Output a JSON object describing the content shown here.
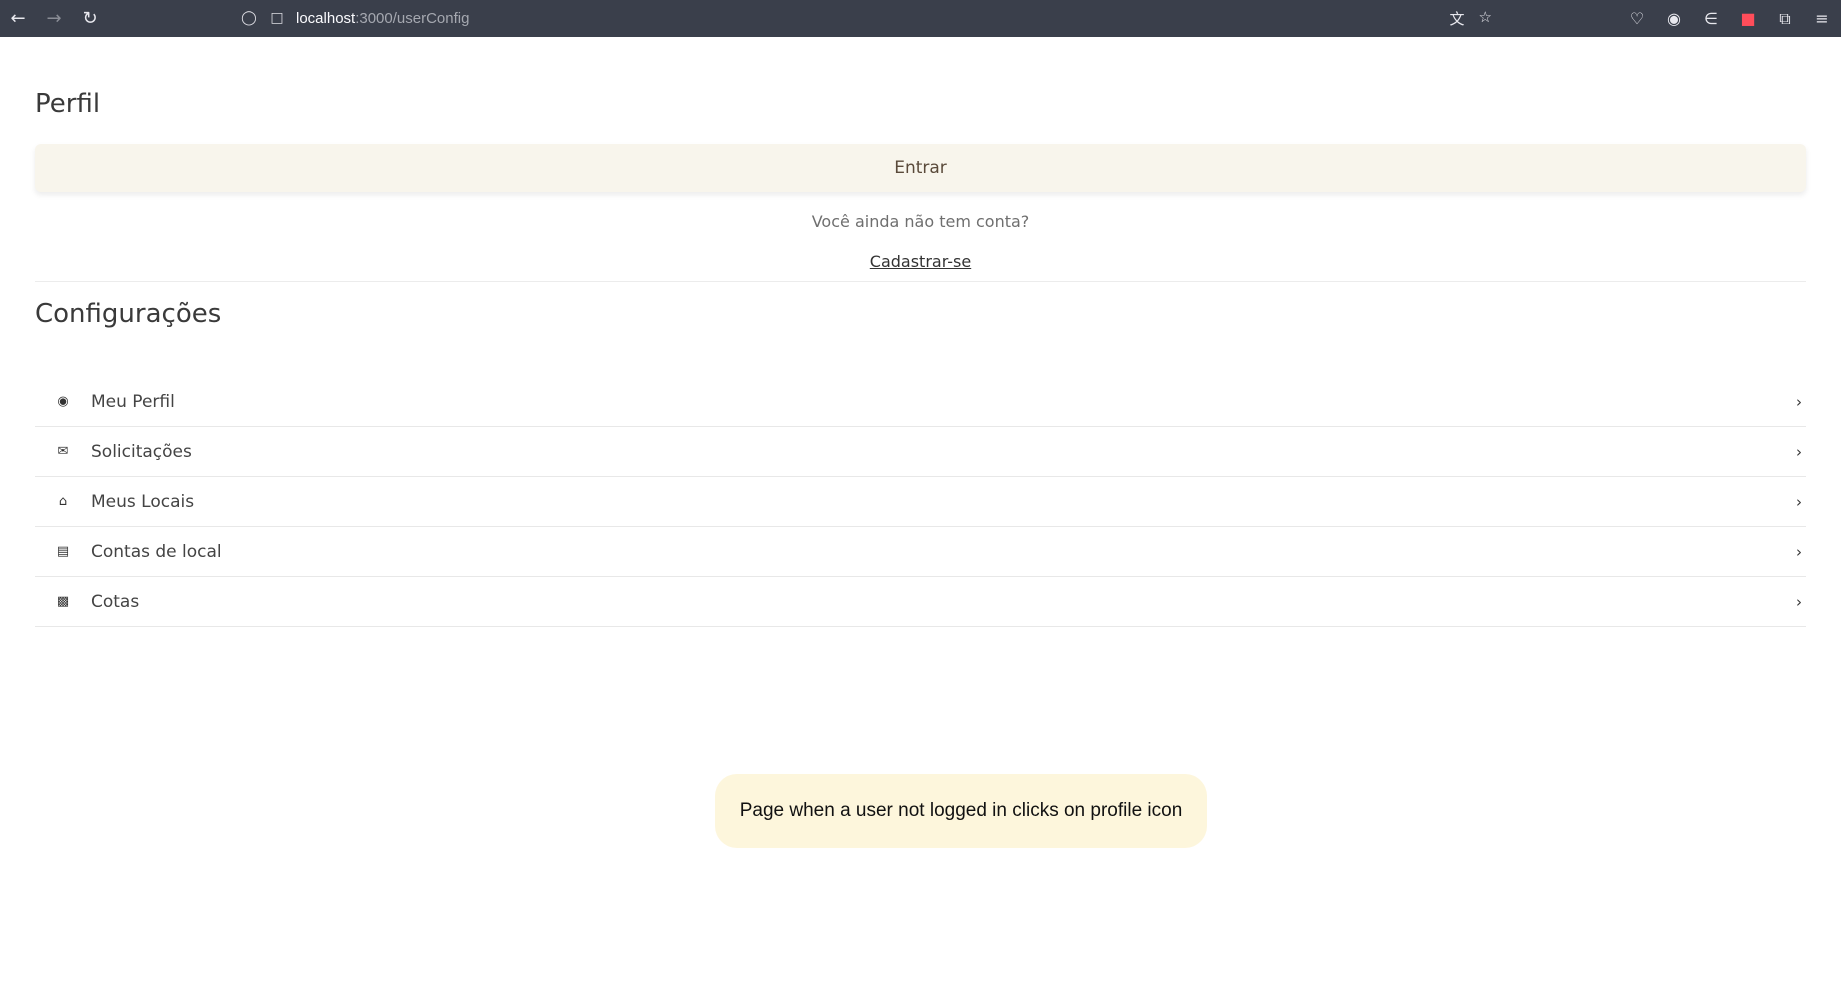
{
  "browser": {
    "url_host": "localhost",
    "url_path": ":3000/userConfig",
    "icons": {
      "back": "arrow-left-icon",
      "forward": "arrow-right-icon",
      "reload": "reload-icon",
      "shield": "shield-icon",
      "page": "page-icon",
      "translate": "translate-icon",
      "bookmark": "star-icon",
      "pocket": "pocket-icon",
      "account": "account-icon",
      "extension1": "extension-icon",
      "extension2": "extension-icon",
      "extensions": "puzzle-icon",
      "menu": "hamburger-menu-icon"
    }
  },
  "profile": {
    "title": "Perfil",
    "login_label": "Entrar",
    "no_account_text": "Você ainda não tem conta?",
    "signup_label": "Cadastrar-se"
  },
  "settings": {
    "title": "Configurações",
    "items": [
      {
        "label": "Meu Perfil",
        "icon": "user-circle-icon"
      },
      {
        "label": "Solicitações",
        "icon": "envelope-icon"
      },
      {
        "label": "Meus Locais",
        "icon": "building-icon"
      },
      {
        "label": "Contas de local",
        "icon": "document-icon"
      },
      {
        "label": "Cotas",
        "icon": "money-icon"
      }
    ]
  },
  "annotation": {
    "text": "Page when a user not logged in clicks on profile icon"
  }
}
